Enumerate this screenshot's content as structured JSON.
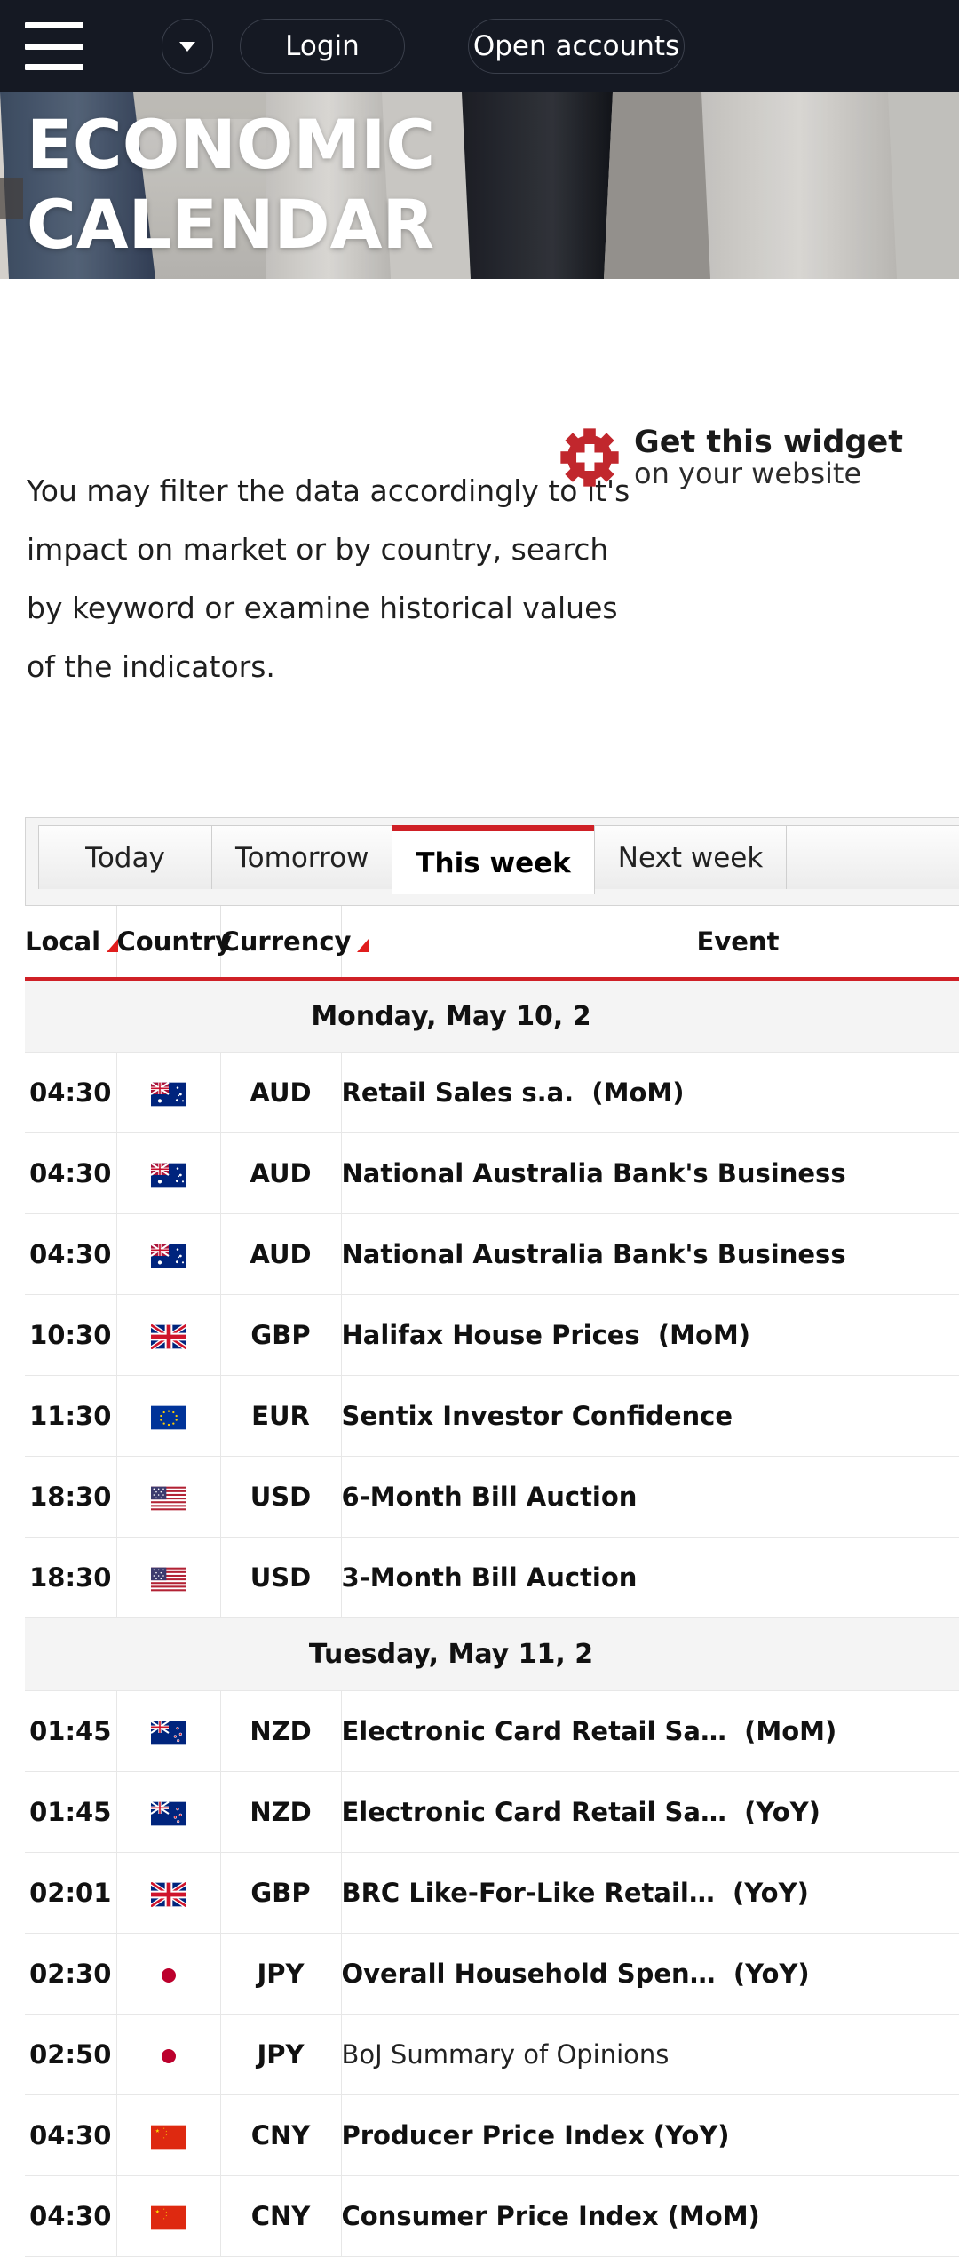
{
  "nav": {
    "menu_icon": "hamburger-icon",
    "lang_caret_icon": "chevron-down-icon",
    "login_label": "Login",
    "open_accounts_label": "Open accounts"
  },
  "hero": {
    "title": "ECONOMIC\nCALENDAR"
  },
  "intro": {
    "text": "You may filter the data accordingly to it's impact on market or by country, search by keyword or examine historical values of the indicators."
  },
  "widget_badge": {
    "icon": "gear-icon",
    "line1": "Get this widget",
    "line2": "on your website",
    "accent_color": "#c1272d"
  },
  "calendar": {
    "accent_color": "#cf2026",
    "tabs": [
      {
        "label": "Today",
        "active": false
      },
      {
        "label": "Tomorrow",
        "active": false
      },
      {
        "label": "This week",
        "active": true
      },
      {
        "label": "Next week",
        "active": false
      },
      {
        "label": "",
        "active": false
      }
    ],
    "columns": [
      {
        "label": "Local",
        "sortable": true
      },
      {
        "label": "Country",
        "sortable": false
      },
      {
        "label": "Currency",
        "sortable": true
      },
      {
        "label": "Event",
        "sortable": false
      }
    ],
    "groups": [
      {
        "date_label": "Monday, May 10, 2",
        "rows": [
          {
            "time": "04:30",
            "flag": "au",
            "currency": "AUD",
            "event": "Retail Sales s.a.",
            "suffix": "(MoM)",
            "bold": true
          },
          {
            "time": "04:30",
            "flag": "au",
            "currency": "AUD",
            "event": "National Australia Bank's Business",
            "suffix": "",
            "bold": true
          },
          {
            "time": "04:30",
            "flag": "au",
            "currency": "AUD",
            "event": "National Australia Bank's Business",
            "suffix": "",
            "bold": true
          },
          {
            "time": "10:30",
            "flag": "gb",
            "currency": "GBP",
            "event": "Halifax House Prices",
            "suffix": "(MoM)",
            "bold": true
          },
          {
            "time": "11:30",
            "flag": "eu",
            "currency": "EUR",
            "event": "Sentix Investor Confidence",
            "suffix": "",
            "bold": true
          },
          {
            "time": "18:30",
            "flag": "us",
            "currency": "USD",
            "event": "6-Month Bill Auction",
            "suffix": "",
            "bold": true
          },
          {
            "time": "18:30",
            "flag": "us",
            "currency": "USD",
            "event": "3-Month Bill Auction",
            "suffix": "",
            "bold": true
          }
        ]
      },
      {
        "date_label": "Tuesday, May 11, 2",
        "rows": [
          {
            "time": "01:45",
            "flag": "nz",
            "currency": "NZD",
            "event": "Electronic Card Retail Sa…",
            "suffix": "(MoM)",
            "bold": true
          },
          {
            "time": "01:45",
            "flag": "nz",
            "currency": "NZD",
            "event": "Electronic Card Retail Sa…",
            "suffix": "(YoY)",
            "bold": true
          },
          {
            "time": "02:01",
            "flag": "gb",
            "currency": "GBP",
            "event": "BRC Like-For-Like Retail…",
            "suffix": "(YoY)",
            "bold": true
          },
          {
            "time": "02:30",
            "flag": "jp",
            "currency": "JPY",
            "event": "Overall Household Spen…",
            "suffix": "(YoY)",
            "bold": true
          },
          {
            "time": "02:50",
            "flag": "jp",
            "currency": "JPY",
            "event": "BoJ Summary of Opinions",
            "suffix": "",
            "bold": false
          },
          {
            "time": "04:30",
            "flag": "cn",
            "currency": "CNY",
            "event": "Producer Price Index (YoY)",
            "suffix": "",
            "bold": true
          },
          {
            "time": "04:30",
            "flag": "cn",
            "currency": "CNY",
            "event": "Consumer Price Index (MoM)",
            "suffix": "",
            "bold": true
          }
        ]
      }
    ]
  }
}
